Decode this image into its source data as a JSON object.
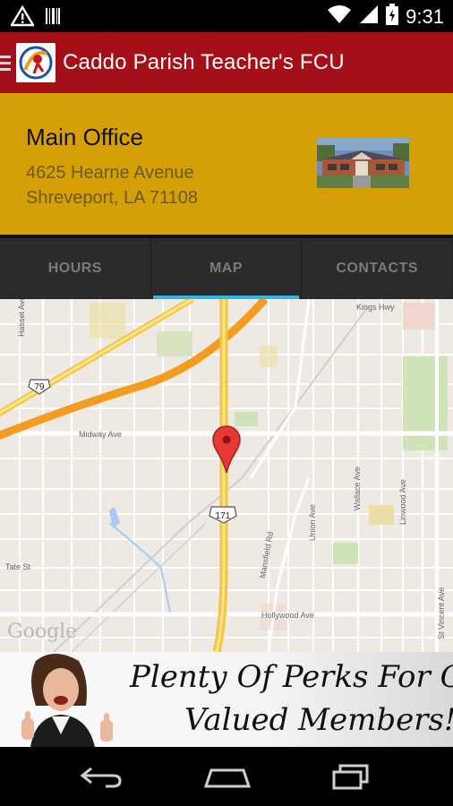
{
  "status_bar": {
    "time": "9:31",
    "icons": [
      "warning-icon",
      "barcode-icon",
      "wifi-icon",
      "signal-icon",
      "battery-icon"
    ]
  },
  "action_bar": {
    "title": "Caddo Parish Teacher's FCU",
    "background": "#a50f17",
    "icons": [
      "menu-icon",
      "app-logo"
    ]
  },
  "office": {
    "name": "Main Office",
    "address_line1": "4625 Hearne Avenue",
    "address_line2": "Shreveport, LA  71108",
    "background": "#d4a005"
  },
  "tabs": [
    {
      "label": "HOURS",
      "active": false
    },
    {
      "label": "MAP",
      "active": true
    },
    {
      "label": "CONTACTS",
      "active": false
    }
  ],
  "tab_indicator_color": "#33b5e5",
  "map": {
    "streets": [
      "Kings Hwy",
      "Hasset Ave",
      "Midway Ave",
      "Tate St",
      "Mansfield Rd",
      "Union Ave",
      "Wallace Ave",
      "Linwood Ave",
      "Hollywood Ave",
      "St Vincent Ave"
    ],
    "route_shields": [
      "79",
      "171"
    ],
    "attribution": "Google",
    "marker": "location-pin-icon"
  },
  "banner": {
    "line1": "Plenty Of Perks For Our",
    "line2": "Valued Members!"
  },
  "nav_bar": {
    "icons": [
      "back-icon",
      "home-icon",
      "recent-apps-icon"
    ]
  }
}
